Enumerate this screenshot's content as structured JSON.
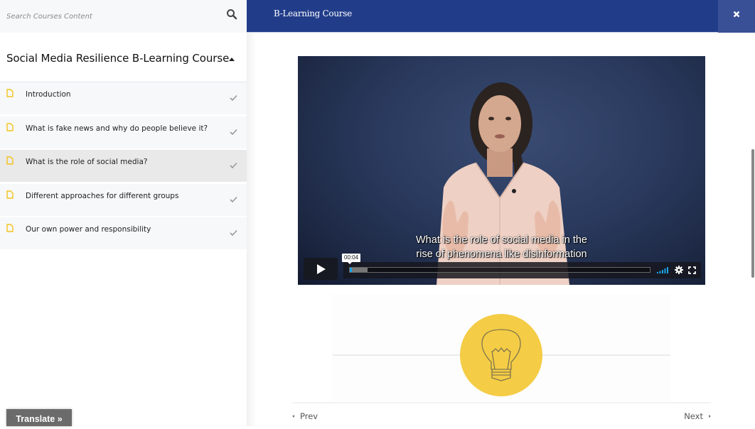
{
  "sidebar": {
    "search": {
      "placeholder": "Search Courses Content",
      "value": "",
      "icon": "search-icon"
    },
    "course_title": "Social Media Resilience B-Learning Course",
    "lessons": [
      {
        "label": "Introduction",
        "icon": "document-icon",
        "completed": true,
        "active": false
      },
      {
        "label": "What is fake news and why do people believe it?",
        "icon": "document-icon",
        "completed": true,
        "active": false
      },
      {
        "label": "What is the role of social media?",
        "icon": "document-icon",
        "completed": true,
        "active": true
      },
      {
        "label": "Different approaches for different groups",
        "icon": "document-icon",
        "completed": true,
        "active": false
      },
      {
        "label": "Our own power and responsibility",
        "icon": "document-icon",
        "completed": true,
        "active": false
      }
    ],
    "translate_label": "Translate »"
  },
  "header": {
    "title": "B-Learning Course",
    "close_icon": "close-icon"
  },
  "video": {
    "subtitle_line1": "What is the role of social media in the",
    "subtitle_line2": "rise of phenomena like disinformation",
    "current_time": "00:04",
    "played_fraction": 0.006,
    "buffered_fraction": 0.06,
    "controls": [
      "play-icon",
      "volume-icon",
      "gear-icon",
      "fullscreen-icon"
    ]
  },
  "illustration": {
    "icon": "lightbulb-icon"
  },
  "pager": {
    "prev_label": "Prev",
    "next_label": "Next"
  },
  "colors": {
    "header_bg": "#213d8a",
    "close_bg": "#394f96",
    "accent_yellow": "#f4cc45",
    "doc_icon_yellow": "#f2c21b",
    "progress_blue": "#1aa4e8",
    "active_lesson_bg": "#e9e9e9"
  }
}
